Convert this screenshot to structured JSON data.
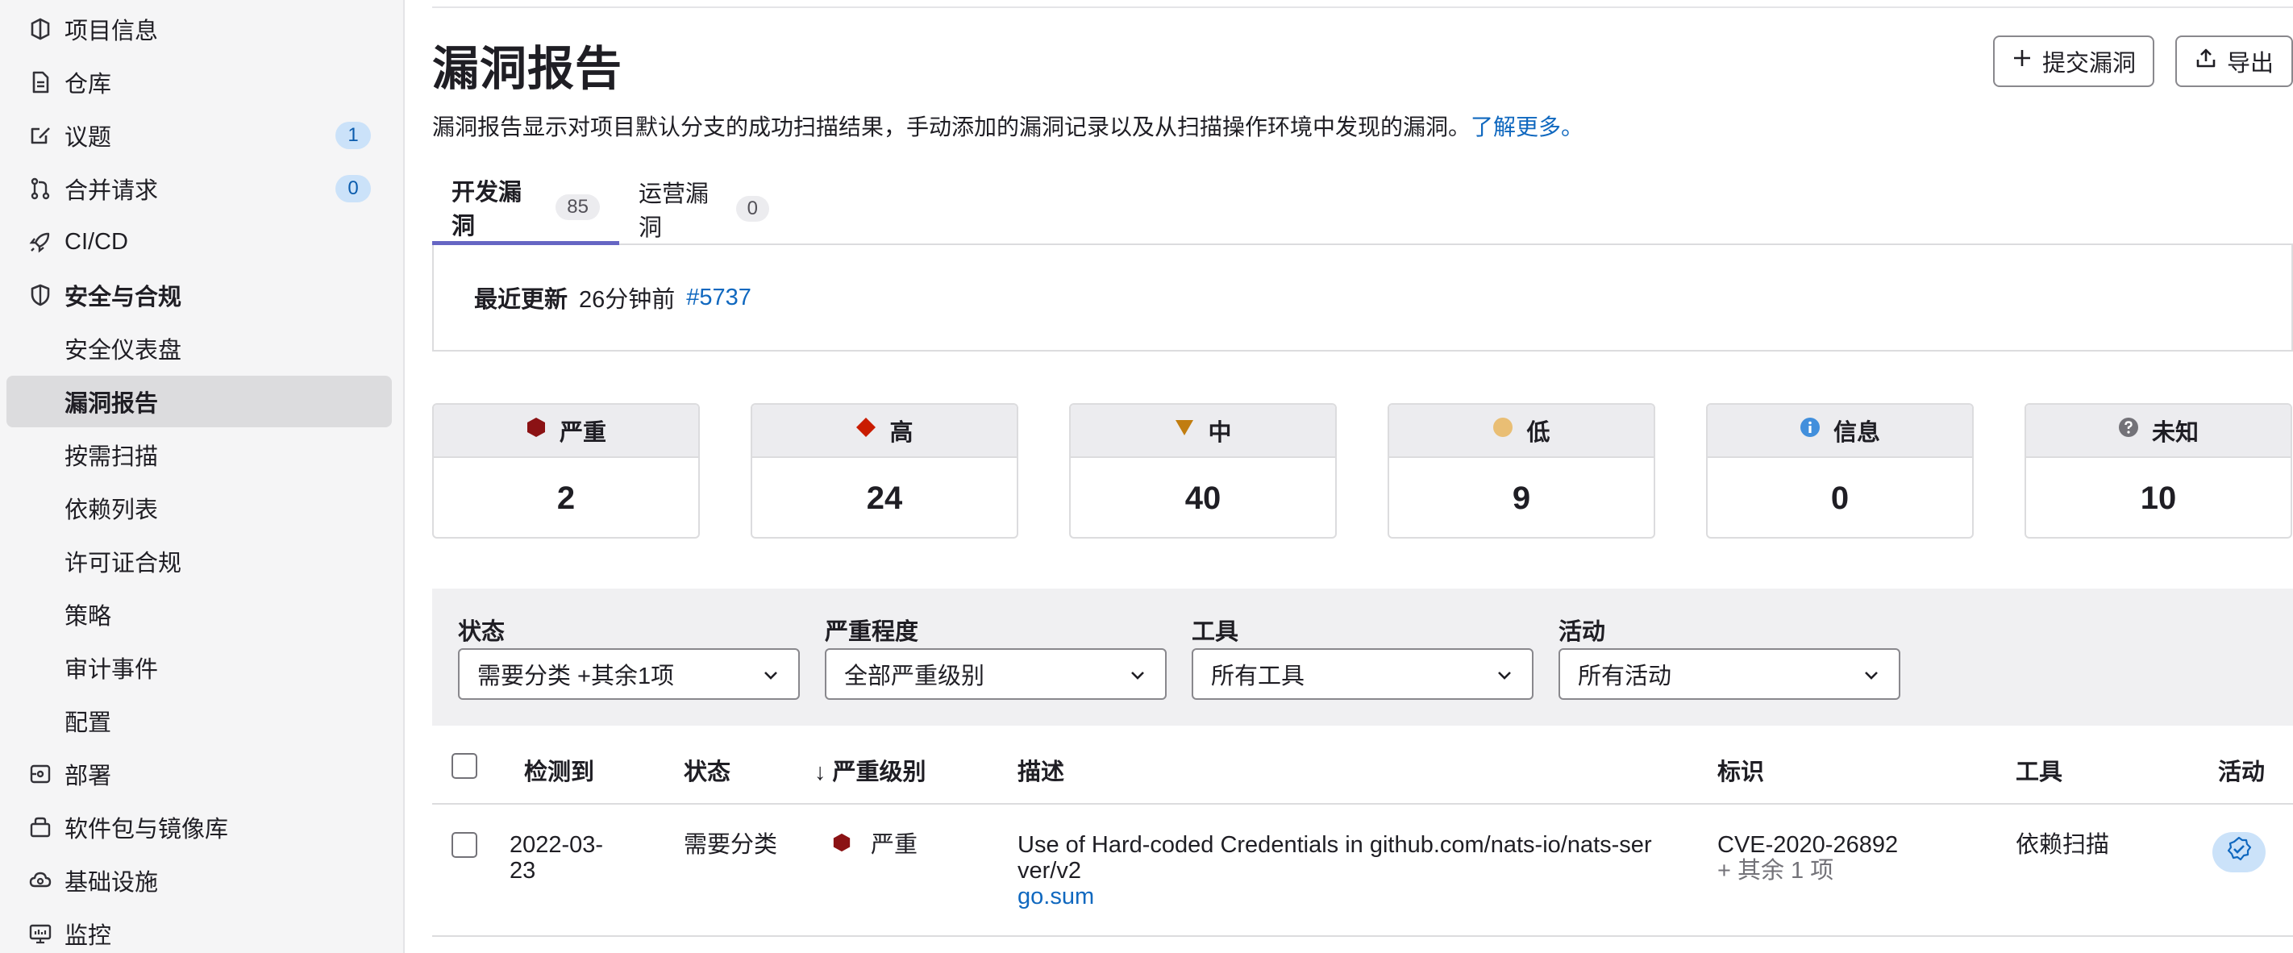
{
  "sidebar": {
    "items": [
      {
        "label": "项目信息",
        "icon": "project-icon"
      },
      {
        "label": "仓库",
        "icon": "document-icon"
      },
      {
        "label": "议题",
        "icon": "issues-icon",
        "badge": "1"
      },
      {
        "label": "合并请求",
        "icon": "merge-request-icon",
        "badge": "0"
      },
      {
        "label": "CI/CD",
        "icon": "rocket-icon"
      },
      {
        "label": "安全与合规",
        "icon": "shield-icon"
      },
      {
        "label": "安全仪表盘"
      },
      {
        "label": "漏洞报告"
      },
      {
        "label": "按需扫描"
      },
      {
        "label": "依赖列表"
      },
      {
        "label": "许可证合规"
      },
      {
        "label": "策略"
      },
      {
        "label": "审计事件"
      },
      {
        "label": "配置"
      },
      {
        "label": "部署",
        "icon": "deployments-icon"
      },
      {
        "label": "软件包与镜像库",
        "icon": "package-icon"
      },
      {
        "label": "基础设施",
        "icon": "cloud-gear-icon"
      },
      {
        "label": "监控",
        "icon": "monitor-icon"
      }
    ]
  },
  "header": {
    "title": "漏洞报告",
    "submit_label": "提交漏洞",
    "export_label": "导出",
    "description": "漏洞报告显示对项目默认分支的成功扫描结果，手动添加的漏洞记录以及从扫描操作环境中发现的漏洞。",
    "learn_more": "了解更多。"
  },
  "tabs": [
    {
      "label": "开发漏洞",
      "count": "85"
    },
    {
      "label": "运营漏洞",
      "count": "0"
    }
  ],
  "update": {
    "label": "最近更新",
    "time": "26分钟前",
    "pipeline": "#5737"
  },
  "severity_cards": [
    {
      "label": "严重",
      "value": "2",
      "icon": "critical-hexagon-icon",
      "color": "#8b1214"
    },
    {
      "label": "高",
      "value": "24",
      "icon": "high-diamond-icon",
      "color": "#c91c00"
    },
    {
      "label": "中",
      "value": "40",
      "icon": "medium-triangle-icon",
      "color": "#c17d10"
    },
    {
      "label": "低",
      "value": "9",
      "icon": "low-circle-icon",
      "color": "#e9be74"
    },
    {
      "label": "信息",
      "value": "0",
      "icon": "info-icon",
      "color": "#428fdc"
    },
    {
      "label": "未知",
      "value": "10",
      "icon": "question-icon",
      "color": "#737278"
    }
  ],
  "filters": [
    {
      "label": "状态",
      "value": "需要分类 +其余1项"
    },
    {
      "label": "严重程度",
      "value": "全部严重级别"
    },
    {
      "label": "工具",
      "value": "所有工具"
    },
    {
      "label": "活动",
      "value": "所有活动"
    }
  ],
  "table": {
    "headers": {
      "detected": "检测到",
      "status": "状态",
      "severity": "↓ 严重级别",
      "description": "描述",
      "identifier": "标识",
      "tool": "工具",
      "activity": "活动"
    },
    "rows": [
      {
        "date_line1": "2022-03-",
        "date_line2": "23",
        "status": "需要分类",
        "severity": "严重",
        "desc_line1": "Use of Hard-coded Credentials in github.com/nats-io/nats-ser",
        "desc_line2": "ver/v2",
        "file": "go.sum",
        "identifier": "CVE-2020-26892",
        "identifier_more": "+ 其余 1 项",
        "tool": "依赖扫描"
      }
    ]
  }
}
